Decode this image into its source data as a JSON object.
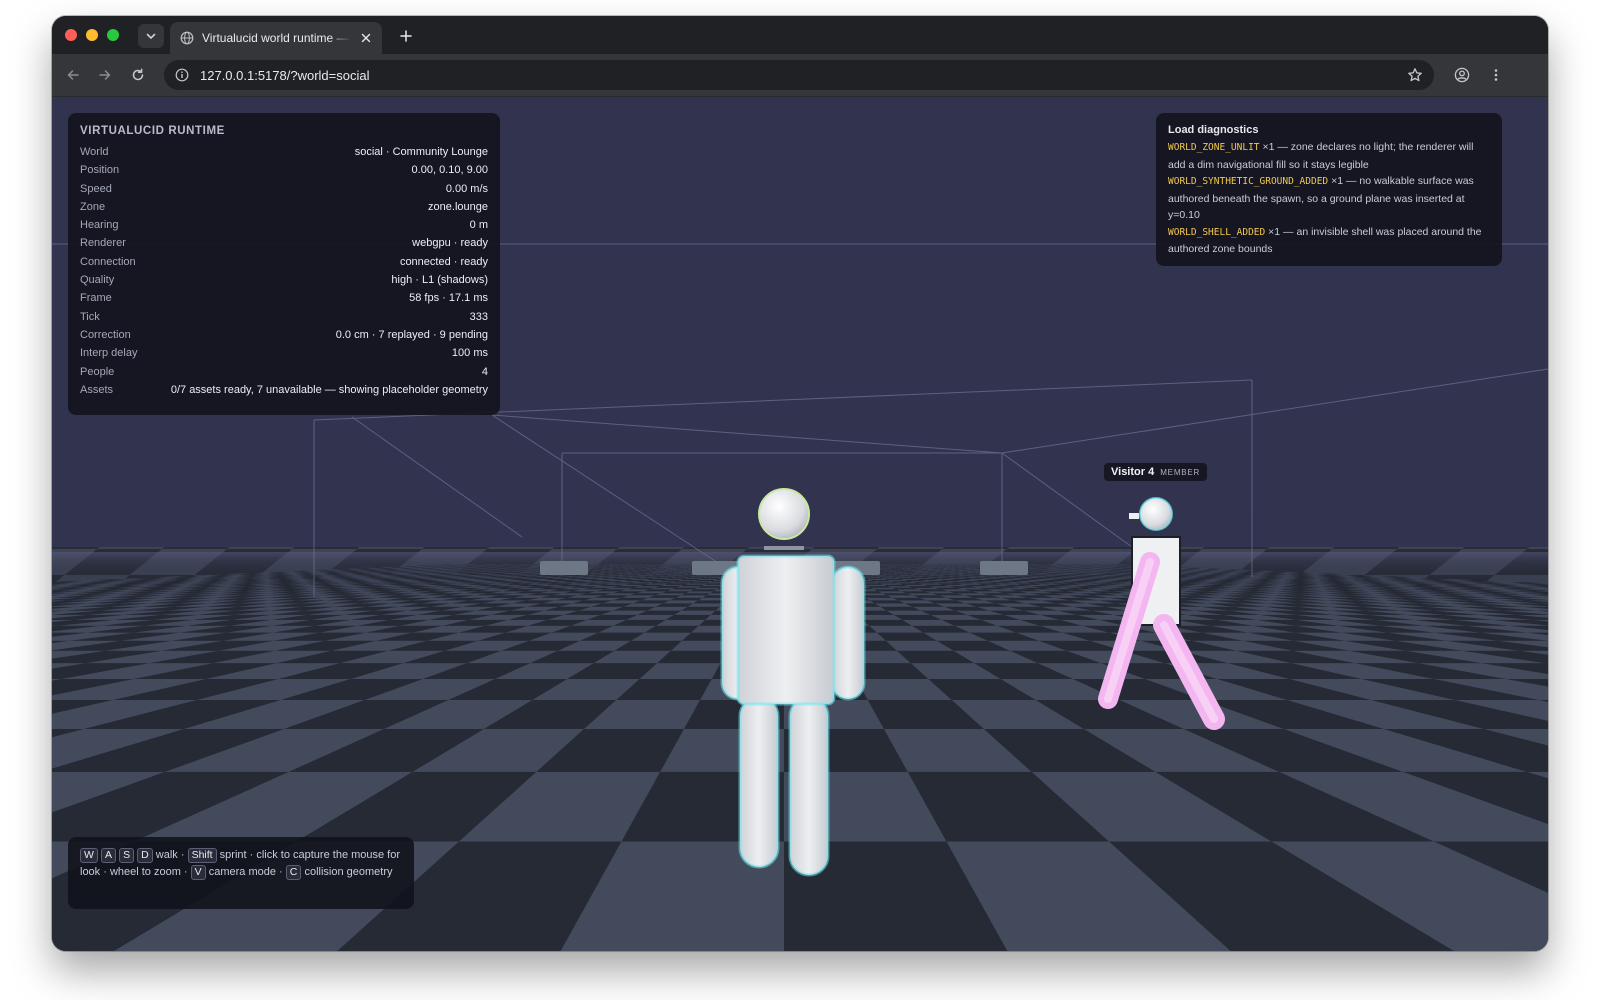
{
  "browser": {
    "tab_title": "Virtualucid world runtime — d",
    "url": "127.0.0.1:5178/?world=social"
  },
  "hud": {
    "title": "VIRTUALUCID RUNTIME",
    "rows": [
      {
        "label": "World",
        "value": "social · Community Lounge"
      },
      {
        "label": "Position",
        "value": "0.00, 0.10, 9.00"
      },
      {
        "label": "Speed",
        "value": "0.00 m/s"
      },
      {
        "label": "Zone",
        "value": "zone.lounge"
      },
      {
        "label": "Hearing",
        "value": "0 m"
      },
      {
        "label": "Renderer",
        "value": "webgpu · ready"
      },
      {
        "label": "Connection",
        "value": "connected · ready"
      },
      {
        "label": "Quality",
        "value": "high · L1 (shadows)"
      },
      {
        "label": "Frame",
        "value": "58 fps · 17.1 ms"
      },
      {
        "label": "Tick",
        "value": "333"
      },
      {
        "label": "Correction",
        "value": "0.0 cm · 7 replayed · 9 pending"
      },
      {
        "label": "Interp delay",
        "value": "100 ms"
      },
      {
        "label": "People",
        "value": "4"
      },
      {
        "label": "Assets",
        "value": "0/7 assets ready, 7 unavailable — showing placeholder geometry"
      }
    ]
  },
  "diagnostics": {
    "title": "Load diagnostics",
    "items": [
      {
        "code": "WORLD_ZONE_UNLIT",
        "count": "×1",
        "text": " — zone declares no light; the renderer will add a dim navigational fill so it stays legible"
      },
      {
        "code": "WORLD_SYNTHETIC_GROUND_ADDED",
        "count": "×1",
        "text": " — no walkable surface was authored beneath the spawn, so a ground plane was inserted at y=0.10"
      },
      {
        "code": "WORLD_SHELL_ADDED",
        "count": "×1",
        "text": " — an invisible shell was placed around the authored zone bounds"
      }
    ]
  },
  "nametag": {
    "name": "Visitor 4",
    "role": "MEMBER"
  },
  "help": {
    "keys_walk": [
      "W",
      "A",
      "S",
      "D"
    ],
    "walk": "walk ·",
    "key_sprint": "Shift",
    "sprint_text": "sprint · click to capture the mouse for look · wheel to zoom ·",
    "key_camera": "V",
    "camera_text": "camera mode ·",
    "key_collision": "C",
    "collision_text": "collision geometry"
  },
  "colors": {
    "diagnostic_code": "#f3c84b",
    "sky": "#32334f",
    "avatar_glow": "#6fe8f0",
    "visitor_limbs": "#f4b6f0"
  }
}
